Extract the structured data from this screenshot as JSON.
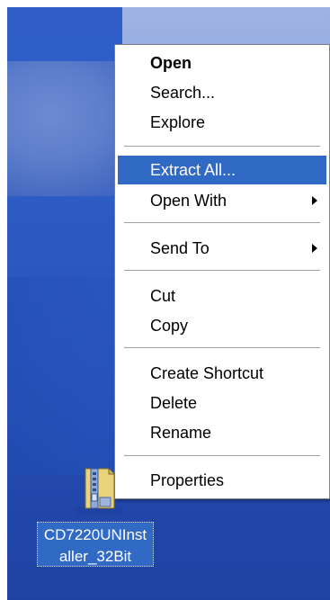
{
  "context_menu": {
    "items": [
      {
        "label": "Open",
        "bold": true
      },
      {
        "label": "Search..."
      },
      {
        "label": "Explore"
      },
      {
        "label": "Extract All...",
        "highlighted": true
      },
      {
        "label": "Open With",
        "submenu": true
      },
      {
        "label": "Send To",
        "submenu": true
      },
      {
        "label": "Cut"
      },
      {
        "label": "Copy"
      },
      {
        "label": "Create Shortcut"
      },
      {
        "label": "Delete"
      },
      {
        "label": "Rename"
      },
      {
        "label": "Properties"
      }
    ]
  },
  "desktop": {
    "file": {
      "name": "CD7220UNInst\naller_32Bit",
      "icon": "zip-folder-icon"
    }
  },
  "colors": {
    "selection": "#316ac5",
    "menu_background": "#ffffff",
    "desktop_blue": "#2a56bd"
  }
}
